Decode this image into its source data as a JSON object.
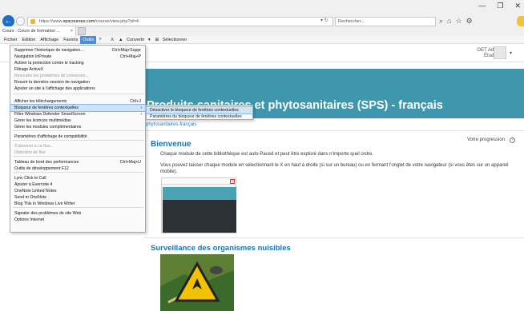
{
  "window": {
    "min": "—",
    "max": "❐",
    "close": "✕"
  },
  "address": {
    "url_prefix": "https://www.",
    "url_domain": "spscourses.com",
    "url_suffix": "/course/view.php?id=4",
    "search_placeholder": "Rechercher..."
  },
  "tab": {
    "title": "Cours : Cours de formation ...",
    "close": "×"
  },
  "menubar": {
    "items": [
      "Fichier",
      "Edition",
      "Affichage",
      "Favoris",
      "Outils",
      "?"
    ],
    "active": "Outils",
    "tools": [
      "X",
      "Convertir",
      "Sélectionner"
    ]
  },
  "user": {
    "name": "OET Admin",
    "role": "Étudiant"
  },
  "page": {
    "banner_title": "Produits sanitaires et phytosanitaires (SPS) - français",
    "breadcrumb": "phytosanitaires-français",
    "welcome": "Bienvenue",
    "progress": "Votre progression",
    "para1": "Chaque module de cette bibliothèque est auto-Paced et peut être exploré dans n'importe quel ordre.",
    "para2": "Vous pouvez laisser chaque module en sélectionnant le X en haut à droite (si sur un bureau) ou en fermant l'onglet de votre navigateur (si vous êtes sur un appareil mobile).",
    "section": "Surveillance des organismes nuisibles"
  },
  "menu": {
    "items": [
      {
        "label": "Supprimer l'historique de navigation...",
        "shortcut": "Ctrl+Maj+Suppr"
      },
      {
        "label": "Navigation InPrivate",
        "shortcut": "Ctrl+Maj+P"
      },
      {
        "label": "Activer la protection contre le tracking",
        "shortcut": ""
      },
      {
        "label": "Filtrage ActiveX",
        "shortcut": ""
      },
      {
        "label": "Résoudre les problèmes de connexion...",
        "shortcut": ""
      },
      {
        "label": "Rouvrir la dernière session de navigation",
        "shortcut": ""
      },
      {
        "label": "Ajouter un site à l'affichage des applications",
        "shortcut": ""
      },
      {
        "label": "Afficher les téléchargements",
        "shortcut": "Ctrl+J"
      },
      {
        "label": "Bloqueur de fenêtres contextuelles",
        "shortcut": ""
      },
      {
        "label": "Filtre Windows Defender SmartScreen",
        "shortcut": ""
      },
      {
        "label": "Gérer les licences multimédias",
        "shortcut": ""
      },
      {
        "label": "Gérer les modules complémentaires",
        "shortcut": ""
      },
      {
        "label": "Paramètres d'affichage de compatibilité",
        "shortcut": ""
      },
      {
        "label": "S'abonner à ce flux...",
        "shortcut": ""
      },
      {
        "label": "Détection de flux",
        "shortcut": ""
      },
      {
        "label": "Tableau de bord des performances",
        "shortcut": "Ctrl+Maj+U"
      },
      {
        "label": "Outils de développement F12",
        "shortcut": ""
      },
      {
        "label": "Lync Click to Call",
        "shortcut": ""
      },
      {
        "label": "Ajouter à Evernote 4",
        "shortcut": ""
      },
      {
        "label": "OneNote Linked Notes",
        "shortcut": ""
      },
      {
        "label": "Send to OneNote",
        "shortcut": ""
      },
      {
        "label": "Blog This in Windows Live Writer",
        "shortcut": ""
      },
      {
        "label": "Signaler des problèmes de site Web",
        "shortcut": ""
      },
      {
        "label": "Options Internet",
        "shortcut": ""
      }
    ],
    "submenu": [
      "Désactiver le bloqueur de fenêtres contextuelles",
      "Paramètres du bloqueur de fenêtres contextuelles"
    ]
  },
  "icons": {
    "back": "arrow-left-icon",
    "forward": "arrow-right-icon",
    "refresh": "refresh-icon",
    "search": "search-icon",
    "home": "home-icon",
    "favorites": "star-icon",
    "settings": "gear-icon",
    "help": "help-icon"
  },
  "colors": {
    "banner": "#3e97ad",
    "link": "#1a73b5",
    "highlight": "#cfe3f7",
    "back_button": "#1e6dc6"
  }
}
